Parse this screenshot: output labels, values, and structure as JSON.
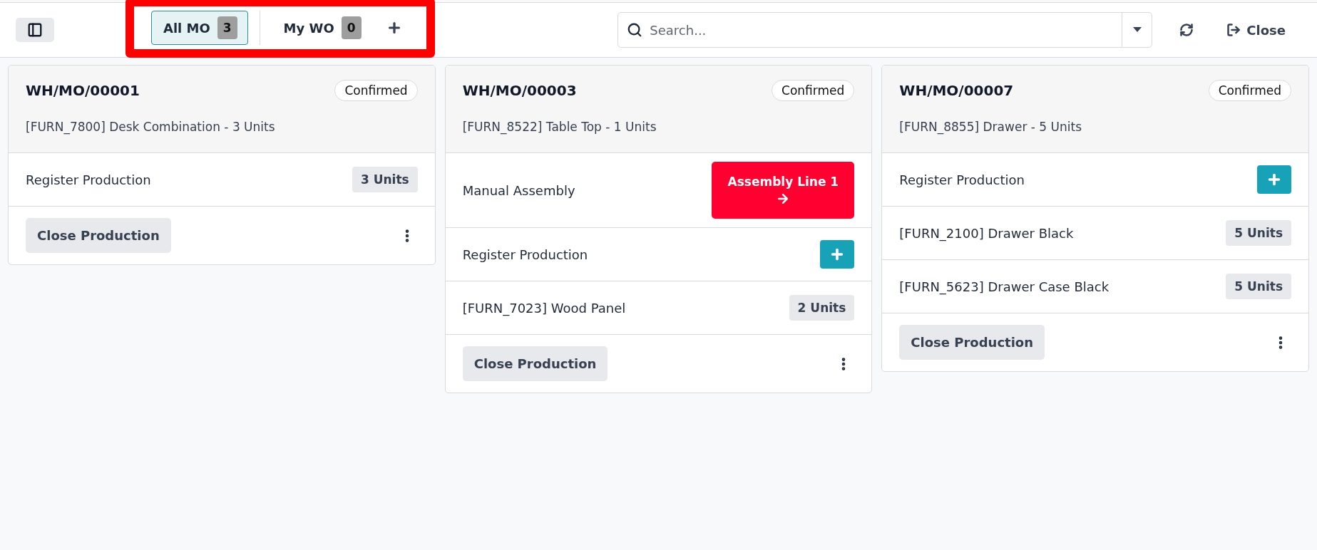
{
  "toolbar": {
    "tabs": [
      {
        "label": "All MO",
        "count": "3",
        "selected": true
      },
      {
        "label": "My WO",
        "count": "0",
        "selected": false
      }
    ],
    "search": {
      "placeholder": "Search..."
    },
    "close_label": "Close"
  },
  "cards": [
    {
      "title": "WH/MO/00001",
      "status": "Confirmed",
      "product": "[FURN_7800] Desk Combination - 3 Units",
      "rows": [
        {
          "kind": "badge",
          "label": "Register Production",
          "value": "3 Units"
        }
      ],
      "close_label": "Close Production"
    },
    {
      "title": "WH/MO/00003",
      "status": "Confirmed",
      "product": "[FURN_8522] Table Top - 1 Units",
      "rows": [
        {
          "kind": "workcenter",
          "label": "Manual Assembly",
          "value": "Assembly Line 1"
        },
        {
          "kind": "plus",
          "label": "Register Production"
        },
        {
          "kind": "badge",
          "label": "[FURN_7023] Wood Panel",
          "value": "2 Units"
        }
      ],
      "close_label": "Close Production"
    },
    {
      "title": "WH/MO/00007",
      "status": "Confirmed",
      "product": "[FURN_8855] Drawer - 5 Units",
      "rows": [
        {
          "kind": "plus",
          "label": "Register Production"
        },
        {
          "kind": "badge",
          "label": "[FURN_2100] Drawer Black",
          "value": "5 Units"
        },
        {
          "kind": "badge",
          "label": "[FURN_5623] Drawer Case Black",
          "value": "5 Units"
        }
      ],
      "close_label": "Close Production"
    }
  ]
}
